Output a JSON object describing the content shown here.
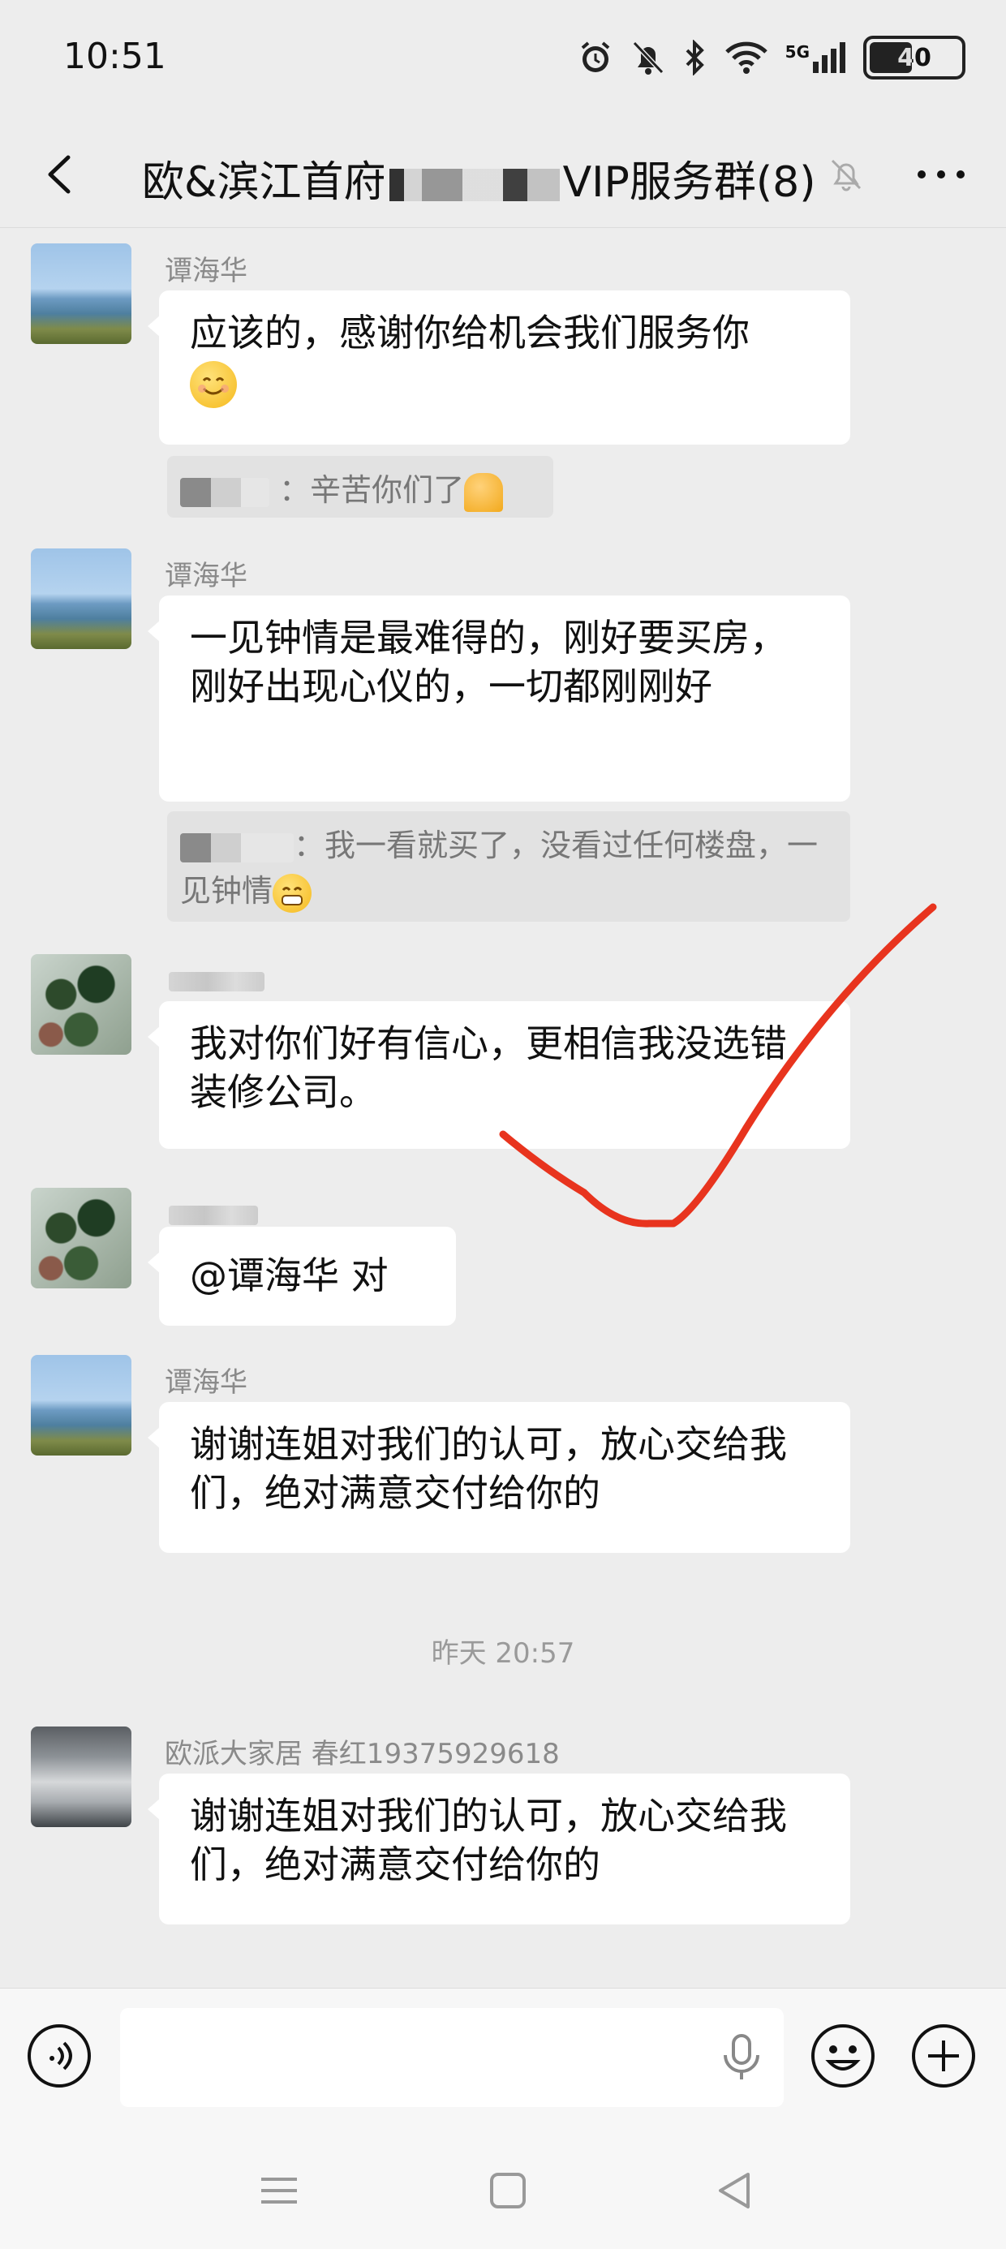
{
  "status_bar": {
    "time": "10:51",
    "network_label": "5G",
    "battery_level": "40"
  },
  "header": {
    "title": "欧&滨江首府",
    "title_tail": "VIP服务群(8)"
  },
  "messages": [
    {
      "sender": "谭海华",
      "text": "应该的，感谢你给机会我们服务你"
    },
    {
      "quote": "辛苦你们了"
    },
    {
      "sender": "谭海华",
      "text": "一见钟情是最难得的，刚好要买房，刚好出现心仪的，一切都刚刚好"
    },
    {
      "quote": "我一看就买了，没看过任何楼盘，一见钟情"
    },
    {
      "text": "我对你们好有信心，更相信我没选错装修公司。"
    },
    {
      "text": "@谭海华  对"
    },
    {
      "sender": "谭海华",
      "text": "谢谢连姐对我们的认可，放心交给我们，绝对满意交付给你的"
    },
    {
      "sender": "欧派大家居  春红19375929618",
      "text": "谢谢连姐对我们的认可，放心交给我们，绝对满意交付给你的"
    }
  ],
  "timestamp": "昨天 20:57",
  "colors": {
    "background": "#ededed",
    "bubble": "#ffffff",
    "annotation_check": "#e8341e"
  },
  "icons": {
    "back": "chevron-left-icon",
    "mute": "bell-off-icon",
    "more": "more-dots-icon",
    "voice": "voice-icon",
    "mic": "mic-icon",
    "emoji": "emoji-icon",
    "plus": "plus-icon"
  }
}
